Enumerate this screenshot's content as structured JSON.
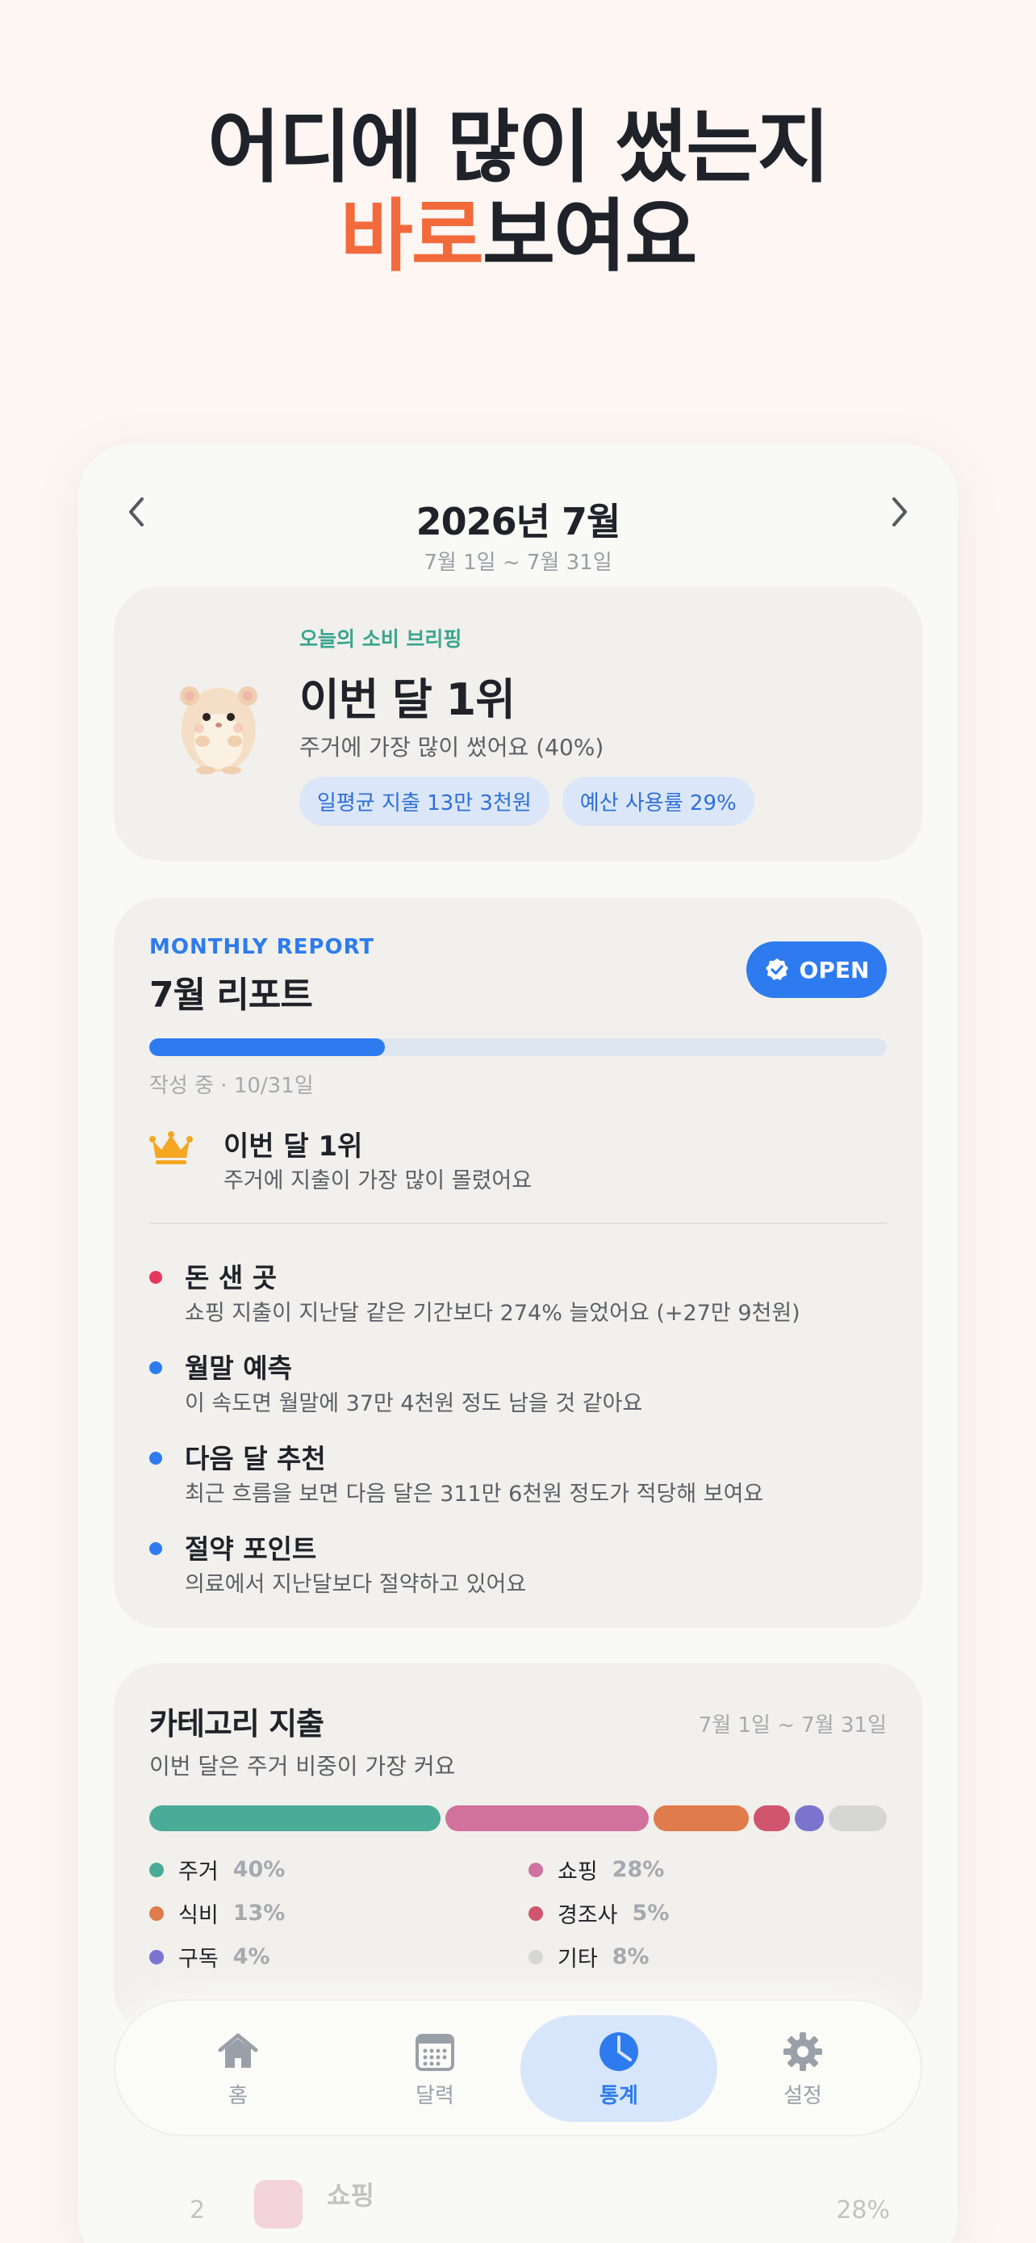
{
  "headline": {
    "line1": "어디에 많이 썼는지",
    "line2_accent": "바로",
    "line2_rest": "보여요"
  },
  "period": {
    "title": "2026년 7월",
    "range": "7월 1일 ~ 7월 31일"
  },
  "briefing": {
    "label": "오늘의 소비 브리핑",
    "title": "이번 달 1위",
    "subtitle": "주거에 가장 많이 썼어요 (40%)",
    "chips": [
      "일평균 지출 13만 3천원",
      "예산 사용률 29%"
    ]
  },
  "report": {
    "eyebrow": "MONTHLY REPORT",
    "title": "7월 리포트",
    "open_label": "OPEN",
    "progress_fraction": 0.32,
    "progress_text": "작성 중 · 10/31일",
    "rank_title": "이번 달 1위",
    "rank_sub": "주거에 지출이 가장 많이 몰렸어요",
    "insights": [
      {
        "title": "돈 샌 곳",
        "desc": "쇼핑 지출이 지난달 같은 기간보다 274% 늘었어요 (+27만 9천원)",
        "color": "#e8385a"
      },
      {
        "title": "월말 예측",
        "desc": "이 속도면 월말에 37만 4천원 정도 남을 것 같아요",
        "color": "#2e7bf0"
      },
      {
        "title": "다음 달 추천",
        "desc": "최근 흐름을 보면 다음 달은 311만 6천원 정도가 적당해 보여요",
        "color": "#2e7bf0"
      },
      {
        "title": "절약 포인트",
        "desc": "의료에서 지난달보다 절약하고 있어요",
        "color": "#2e7bf0"
      }
    ]
  },
  "category": {
    "title": "카테고리 지출",
    "range": "7월 1일 ~ 7월 31일",
    "subtitle": "이번 달은 주거 비중이 가장 커요",
    "items": [
      {
        "name": "주거",
        "percent": "40%",
        "value": 40,
        "color": "#4aab98"
      },
      {
        "name": "쇼핑",
        "percent": "28%",
        "value": 28,
        "color": "#d0719e"
      },
      {
        "name": "식비",
        "percent": "13%",
        "value": 13,
        "color": "#e07b4c"
      },
      {
        "name": "경조사",
        "percent": "5%",
        "value": 5,
        "color": "#d1546e"
      },
      {
        "name": "구독",
        "percent": "4%",
        "value": 4,
        "color": "#7b74cf"
      },
      {
        "name": "기타",
        "percent": "8%",
        "value": 8,
        "color": "#d6d6d4"
      }
    ]
  },
  "faded_row": {
    "rank": "2",
    "name": "쇼핑",
    "percent": "28%"
  },
  "tabs": [
    {
      "label": "홈",
      "icon": "home-icon",
      "active": false
    },
    {
      "label": "달력",
      "icon": "calendar-icon",
      "active": false
    },
    {
      "label": "통계",
      "icon": "pie-chart-icon",
      "active": true
    },
    {
      "label": "설정",
      "icon": "gear-icon",
      "active": false
    }
  ],
  "colors": {
    "accent": "#f26a3b",
    "primary": "#2e7bf0",
    "teal": "#3aa58f"
  }
}
